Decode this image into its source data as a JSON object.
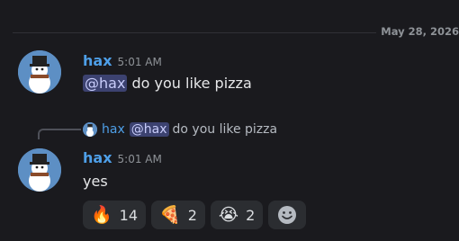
{
  "divider": {
    "date": "May 28, 2026"
  },
  "messages": [
    {
      "author": "hax",
      "time": "5:01 AM",
      "mention": "@hax",
      "text": "do you like pizza"
    },
    {
      "reply": {
        "author": "hax",
        "mention": "@hax",
        "text": "do you like pizza"
      },
      "author": "hax",
      "time": "5:01 AM",
      "text": "yes",
      "reactions": [
        {
          "emoji": "🔥",
          "icon": "fire-icon",
          "count": "14"
        },
        {
          "emoji": "🍕",
          "icon": "pizza-icon",
          "count": "2"
        },
        {
          "emoji": "😭",
          "icon": "crying-face-icon",
          "count": "2"
        }
      ],
      "add_reaction_icon": "smiley-icon"
    }
  ],
  "colors": {
    "username": "#4e9fe8",
    "mention_bg": "#3c4270",
    "background": "#1a1a1e"
  }
}
